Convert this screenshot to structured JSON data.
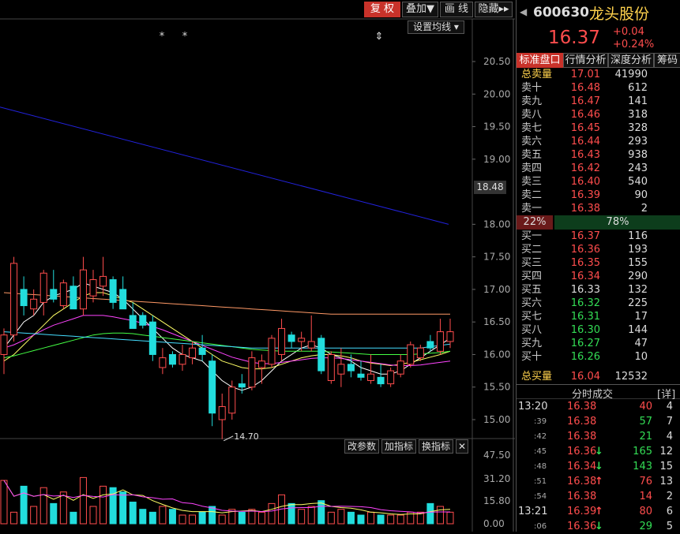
{
  "toolbar": {
    "fuquan": "复 权",
    "diejia": "叠加▼",
    "huaxian": "画 线",
    "yincang": "隐藏▸▸",
    "set_ma": "设置均线 ▾"
  },
  "chart": {
    "y_ticks": [
      "20.50",
      "20.00",
      "19.50",
      "19.00",
      "18.00",
      "17.50",
      "17.00",
      "16.50",
      "16.00",
      "15.50",
      "15.00"
    ],
    "current_price_label": "18.48",
    "low_label": "14.70",
    "markers": [
      "*",
      "*",
      "⇕"
    ]
  },
  "indicator": {
    "buttons": {
      "gaican": "改参数",
      "jiazb": "加指标",
      "huanzb": "换指标",
      "close": "✕"
    },
    "y_ticks": [
      "47.50",
      "31.20",
      "15.80",
      "0.00"
    ]
  },
  "chart_data": {
    "type": "candlestick",
    "ylim": [
      14.7,
      20.6
    ],
    "candles": [
      {
        "o": 16.0,
        "h": 16.4,
        "l": 15.7,
        "c": 16.3
      },
      {
        "o": 16.3,
        "h": 17.5,
        "l": 16.2,
        "c": 17.4
      },
      {
        "o": 17.0,
        "h": 17.2,
        "l": 16.6,
        "c": 16.75
      },
      {
        "o": 16.7,
        "h": 17.0,
        "l": 16.6,
        "c": 16.85
      },
      {
        "o": 16.8,
        "h": 17.3,
        "l": 16.6,
        "c": 17.25
      },
      {
        "o": 17.0,
        "h": 17.3,
        "l": 16.8,
        "c": 16.85
      },
      {
        "o": 16.75,
        "h": 17.15,
        "l": 16.7,
        "c": 17.1
      },
      {
        "o": 17.05,
        "h": 17.2,
        "l": 16.8,
        "c": 16.7
      },
      {
        "o": 16.7,
        "h": 17.5,
        "l": 16.6,
        "c": 17.3
      },
      {
        "o": 16.9,
        "h": 17.3,
        "l": 16.8,
        "c": 17.15
      },
      {
        "o": 17.05,
        "h": 17.5,
        "l": 16.9,
        "c": 17.2
      },
      {
        "o": 17.15,
        "h": 17.2,
        "l": 16.7,
        "c": 16.8
      },
      {
        "o": 17.0,
        "h": 17.2,
        "l": 16.8,
        "c": 16.7
      },
      {
        "o": 16.6,
        "h": 16.8,
        "l": 16.4,
        "c": 16.4
      },
      {
        "o": 16.6,
        "h": 16.65,
        "l": 16.4,
        "c": 16.45
      },
      {
        "o": 16.5,
        "h": 16.6,
        "l": 15.9,
        "c": 16.0
      },
      {
        "o": 15.8,
        "h": 16.1,
        "l": 15.7,
        "c": 15.95
      },
      {
        "o": 16.0,
        "h": 16.05,
        "l": 15.8,
        "c": 15.85
      },
      {
        "o": 15.85,
        "h": 16.15,
        "l": 15.75,
        "c": 16.0
      },
      {
        "o": 15.95,
        "h": 16.2,
        "l": 15.85,
        "c": 16.1
      },
      {
        "o": 16.1,
        "h": 16.3,
        "l": 15.9,
        "c": 16.0
      },
      {
        "o": 15.9,
        "h": 16.0,
        "l": 14.9,
        "c": 15.1
      },
      {
        "o": 15.0,
        "h": 15.4,
        "l": 14.7,
        "c": 15.2
      },
      {
        "o": 15.1,
        "h": 15.6,
        "l": 15.0,
        "c": 15.5
      },
      {
        "o": 15.55,
        "h": 15.7,
        "l": 15.4,
        "c": 15.5
      },
      {
        "o": 15.5,
        "h": 16.05,
        "l": 15.45,
        "c": 15.95
      },
      {
        "o": 15.8,
        "h": 16.0,
        "l": 15.55,
        "c": 15.9
      },
      {
        "o": 15.85,
        "h": 16.3,
        "l": 15.8,
        "c": 16.25
      },
      {
        "o": 16.0,
        "h": 16.55,
        "l": 15.9,
        "c": 16.4
      },
      {
        "o": 16.3,
        "h": 16.35,
        "l": 16.1,
        "c": 16.2
      },
      {
        "o": 16.2,
        "h": 16.35,
        "l": 16.05,
        "c": 16.25
      },
      {
        "o": 16.1,
        "h": 16.6,
        "l": 16.05,
        "c": 16.2
      },
      {
        "o": 16.25,
        "h": 16.3,
        "l": 15.7,
        "c": 15.75
      },
      {
        "o": 15.6,
        "h": 16.05,
        "l": 15.55,
        "c": 16.0
      },
      {
        "o": 15.7,
        "h": 16.1,
        "l": 15.5,
        "c": 15.85
      },
      {
        "o": 15.85,
        "h": 16.0,
        "l": 15.65,
        "c": 15.75
      },
      {
        "o": 15.7,
        "h": 15.9,
        "l": 15.6,
        "c": 15.65
      },
      {
        "o": 15.6,
        "h": 16.0,
        "l": 15.55,
        "c": 15.7
      },
      {
        "o": 15.65,
        "h": 15.85,
        "l": 15.5,
        "c": 15.55
      },
      {
        "o": 15.55,
        "h": 15.8,
        "l": 15.5,
        "c": 15.75
      },
      {
        "o": 15.7,
        "h": 16.0,
        "l": 15.65,
        "c": 15.9
      },
      {
        "o": 15.85,
        "h": 16.2,
        "l": 15.8,
        "c": 16.15
      },
      {
        "o": 15.95,
        "h": 16.15,
        "l": 15.9,
        "c": 16.1
      },
      {
        "o": 16.2,
        "h": 16.3,
        "l": 16.05,
        "c": 16.1
      },
      {
        "o": 16.05,
        "h": 16.55,
        "l": 16.0,
        "c": 16.35
      },
      {
        "o": 16.2,
        "h": 16.55,
        "l": 16.1,
        "c": 16.35
      }
    ],
    "ma_lines": [
      {
        "color": "#ffffff",
        "values": [
          16.1,
          16.3,
          16.5,
          16.6,
          16.8,
          16.9,
          16.95,
          17.0,
          17.1,
          17.05,
          17.0,
          16.95,
          16.85,
          16.7,
          16.55,
          16.4,
          16.25,
          16.1,
          16.0,
          15.95,
          15.9,
          15.75,
          15.6,
          15.5,
          15.45,
          15.5,
          15.6,
          15.75,
          15.9,
          16.0,
          16.1,
          16.15,
          16.1,
          16.0,
          15.95,
          15.9,
          15.8,
          15.75,
          15.7,
          15.7,
          15.75,
          15.85,
          15.95,
          16.05,
          16.15,
          16.25
        ]
      },
      {
        "color": "#ffff66",
        "values": [
          15.9,
          16.0,
          16.15,
          16.3,
          16.45,
          16.6,
          16.7,
          16.8,
          16.9,
          16.95,
          16.95,
          16.9,
          16.85,
          16.8,
          16.7,
          16.6,
          16.5,
          16.4,
          16.3,
          16.2,
          16.1,
          16.0,
          15.9,
          15.85,
          15.8,
          15.78,
          15.78,
          15.8,
          15.85,
          15.9,
          15.95,
          15.98,
          16.0,
          16.0,
          15.98,
          15.95,
          15.9,
          15.87,
          15.85,
          15.83,
          15.85,
          15.88,
          15.92,
          15.96,
          16.0,
          16.05
        ]
      },
      {
        "color": "#ff44ff",
        "values": [
          16.1,
          16.15,
          16.22,
          16.3,
          16.38,
          16.45,
          16.5,
          16.55,
          16.6,
          16.6,
          16.6,
          16.58,
          16.55,
          16.52,
          16.48,
          16.43,
          16.38,
          16.32,
          16.26,
          16.2,
          16.14,
          16.08,
          16.02,
          15.96,
          15.92,
          15.88,
          15.86,
          15.86,
          15.88,
          15.9,
          15.92,
          15.94,
          15.95,
          15.95,
          15.94,
          15.92,
          15.9,
          15.88,
          15.86,
          15.84,
          15.83,
          15.83,
          15.84,
          15.86,
          15.88,
          15.9
        ]
      },
      {
        "color": "#44ff44",
        "values": [
          15.95,
          15.98,
          16.02,
          16.06,
          16.1,
          16.14,
          16.18,
          16.22,
          16.26,
          16.3,
          16.32,
          16.33,
          16.33,
          16.32,
          16.3,
          16.28,
          16.26,
          16.24,
          16.22,
          16.2,
          16.18,
          16.16,
          16.14,
          16.12,
          16.1,
          16.08,
          16.07,
          16.06,
          16.05,
          16.05,
          16.05,
          16.05,
          16.05,
          16.04,
          16.03,
          16.02,
          16.01,
          16.0,
          16.0,
          16.0,
          16.0,
          16.0,
          16.01,
          16.02,
          16.03,
          16.05
        ]
      },
      {
        "color": "#44ddff",
        "values": [
          16.35,
          16.34,
          16.33,
          16.32,
          16.31,
          16.3,
          16.29,
          16.28,
          16.27,
          16.26,
          16.25,
          16.24,
          16.23,
          16.22,
          16.21,
          16.2,
          16.19,
          16.18,
          16.17,
          16.16,
          16.15,
          16.14,
          16.13,
          16.12,
          16.11,
          16.1,
          16.1,
          16.1,
          16.1,
          16.1,
          16.1,
          16.1,
          16.1,
          16.1,
          16.1,
          16.1,
          16.1,
          16.1,
          16.1,
          16.1,
          16.1,
          16.1,
          16.1,
          16.12,
          16.14,
          16.16
        ]
      },
      {
        "color": "#ff9966",
        "values": [
          16.95,
          16.94,
          16.93,
          16.92,
          16.91,
          16.9,
          16.89,
          16.88,
          16.87,
          16.86,
          16.85,
          16.84,
          16.83,
          16.82,
          16.81,
          16.8,
          16.79,
          16.78,
          16.77,
          16.76,
          16.75,
          16.74,
          16.73,
          16.72,
          16.71,
          16.7,
          16.69,
          16.68,
          16.67,
          16.66,
          16.65,
          16.64,
          16.63,
          16.62,
          16.62,
          16.62,
          16.62,
          16.62,
          16.62,
          16.62,
          16.62,
          16.62,
          16.62,
          16.62,
          16.62,
          16.62
        ]
      }
    ],
    "long_ma": {
      "color": "#2222dd",
      "from": 19.8,
      "to": 18.0
    },
    "volume": [
      30,
      8,
      26,
      12,
      25,
      14,
      22,
      8,
      32,
      12,
      26,
      25,
      22,
      15,
      10,
      8,
      12,
      10,
      6,
      6,
      8,
      12,
      6,
      10,
      8,
      10,
      8,
      14,
      20,
      14,
      10,
      12,
      16,
      8,
      10,
      8,
      6,
      8,
      6,
      6,
      6,
      8,
      8,
      14,
      12,
      8
    ],
    "volume_ylim": [
      0,
      47.5
    ]
  },
  "panel": {
    "code": "600630",
    "name": "龙头股份",
    "price": "16.37",
    "change": "+0.04",
    "change_pct": "+0.24%",
    "tabs": [
      "标准盘口",
      "行情分析",
      "深度分析",
      "筹码"
    ],
    "total_sell": {
      "label": "总卖量",
      "price": "17.01",
      "vol": "41990"
    },
    "sells": [
      {
        "label": "卖十",
        "price": "16.48",
        "vol": "612"
      },
      {
        "label": "卖九",
        "price": "16.47",
        "vol": "141"
      },
      {
        "label": "卖八",
        "price": "16.46",
        "vol": "318"
      },
      {
        "label": "卖七",
        "price": "16.45",
        "vol": "328"
      },
      {
        "label": "卖六",
        "price": "16.44",
        "vol": "293"
      },
      {
        "label": "卖五",
        "price": "16.43",
        "vol": "938"
      },
      {
        "label": "卖四",
        "price": "16.42",
        "vol": "243"
      },
      {
        "label": "卖三",
        "price": "16.40",
        "vol": "540"
      },
      {
        "label": "卖二",
        "price": "16.39",
        "vol": "90"
      },
      {
        "label": "卖一",
        "price": "16.38",
        "vol": "2"
      }
    ],
    "ratio": {
      "sell": "22%",
      "buy": "78%"
    },
    "buys": [
      {
        "label": "买一",
        "price": "16.37",
        "vol": "116",
        "color": "#ff4d4d"
      },
      {
        "label": "买二",
        "price": "16.36",
        "vol": "193",
        "color": "#ff4d4d"
      },
      {
        "label": "买三",
        "price": "16.35",
        "vol": "155",
        "color": "#ff4d4d"
      },
      {
        "label": "买四",
        "price": "16.34",
        "vol": "290",
        "color": "#ff4d4d"
      },
      {
        "label": "买五",
        "price": "16.33",
        "vol": "132",
        "color": "#dddddd"
      },
      {
        "label": "买六",
        "price": "16.32",
        "vol": "225",
        "color": "#33dd55"
      },
      {
        "label": "买七",
        "price": "16.31",
        "vol": "17",
        "color": "#33dd55"
      },
      {
        "label": "买八",
        "price": "16.30",
        "vol": "144",
        "color": "#33dd55"
      },
      {
        "label": "买九",
        "price": "16.27",
        "vol": "47",
        "color": "#33dd55"
      },
      {
        "label": "买十",
        "price": "16.26",
        "vol": "10",
        "color": "#33dd55"
      }
    ],
    "total_buy": {
      "label": "总买量",
      "price": "16.04",
      "vol": "12532"
    },
    "ticks_title": "分时成交",
    "ticks_detail": "[详]",
    "ticks": [
      {
        "time": "13:20",
        "small": false,
        "price": "16.38",
        "arrow": "",
        "vol": "40",
        "vcolor": "#ff4d4d",
        "n": "4"
      },
      {
        "time": ":39",
        "small": true,
        "price": "16.38",
        "arrow": "",
        "vol": "57",
        "vcolor": "#33dd55",
        "n": "7"
      },
      {
        "time": ":42",
        "small": true,
        "price": "16.38",
        "arrow": "",
        "vol": "21",
        "vcolor": "#33dd55",
        "n": "4"
      },
      {
        "time": ":45",
        "small": true,
        "price": "16.36",
        "arrow": "↓",
        "acolor": "#33dd55",
        "vol": "165",
        "vcolor": "#33dd55",
        "n": "12"
      },
      {
        "time": ":48",
        "small": true,
        "price": "16.34",
        "arrow": "↓",
        "acolor": "#33dd55",
        "vol": "143",
        "vcolor": "#33dd55",
        "n": "15"
      },
      {
        "time": ":51",
        "small": true,
        "price": "16.38",
        "arrow": "↑",
        "acolor": "#ff4d4d",
        "vol": "76",
        "vcolor": "#ff4d4d",
        "n": "13"
      },
      {
        "time": ":54",
        "small": true,
        "price": "16.38",
        "arrow": "",
        "vol": "14",
        "vcolor": "#ff4d4d",
        "n": "2"
      },
      {
        "time": "13:21",
        "small": false,
        "price": "16.39",
        "arrow": "↑",
        "acolor": "#ff4d4d",
        "vol": "80",
        "vcolor": "#ff4d4d",
        "n": "6"
      },
      {
        "time": ":06",
        "small": true,
        "price": "16.36",
        "arrow": "↓",
        "acolor": "#33dd55",
        "vol": "29",
        "vcolor": "#33dd55",
        "n": "5"
      }
    ]
  }
}
